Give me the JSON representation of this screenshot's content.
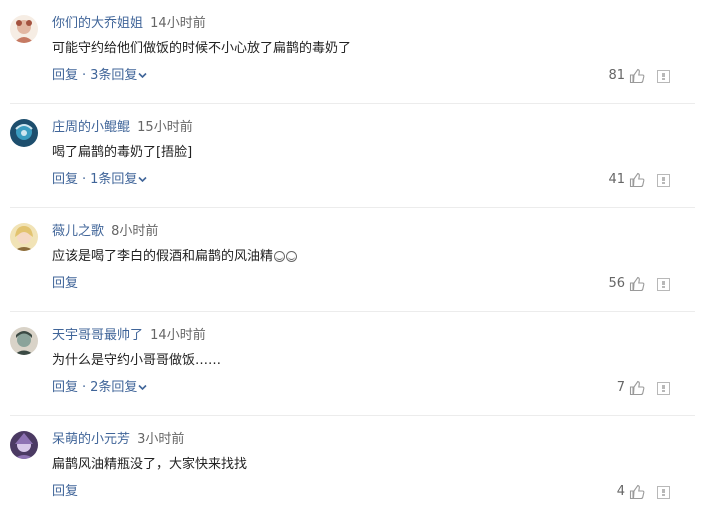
{
  "comments": [
    {
      "username": "你们的大乔姐姐",
      "time": "14小时前",
      "content": "可能守约给他们做饭的时候不小心放了扁鹊的毒奶了",
      "reply_label": "回复",
      "sep": "·",
      "replies": "3条回复",
      "likes": "81",
      "avatar_colors": [
        "#f6ede4",
        "#e2b7a2",
        "#c67a63"
      ],
      "has_emoji": false
    },
    {
      "username": "庄周的小鲲鲲",
      "time": "15小时前",
      "content": "喝了扁鹊的毒奶了[捂脸]",
      "reply_label": "回复",
      "sep": "·",
      "replies": "1条回复",
      "likes": "41",
      "avatar_colors": [
        "#1d4e6d",
        "#3a9cc0",
        "#cfe6f0"
      ],
      "has_emoji": false
    },
    {
      "username": "薇儿之歌",
      "time": "8小时前",
      "content": "应该是喝了李白的假酒和扁鹊的风油精",
      "reply_label": "回复",
      "sep": "",
      "replies": "",
      "likes": "56",
      "avatar_colors": [
        "#f1e3b6",
        "#e2c36f",
        "#8b6b3a"
      ],
      "has_emoji": true
    },
    {
      "username": "天宇哥哥最帅了",
      "time": "14小时前",
      "content": "为什么是守约小哥哥做饭……",
      "reply_label": "回复",
      "sep": "·",
      "replies": "2条回复",
      "likes": "7",
      "avatar_colors": [
        "#3b4a44",
        "#8aa39a",
        "#d9d3c8"
      ],
      "has_emoji": false
    },
    {
      "username": "呆萌的小元芳",
      "time": "3小时前",
      "content": "扁鹊风油精瓶没了，大家快来找找",
      "reply_label": "回复",
      "sep": "",
      "replies": "",
      "likes": "4",
      "avatar_colors": [
        "#4b3a63",
        "#8d72b3",
        "#d8c9ea"
      ],
      "has_emoji": false
    }
  ],
  "icons": {
    "like": "thumbs-up-icon",
    "report": "report-icon",
    "expand": "chevron-down-icon",
    "emoji": "smiley-emoji-icon"
  },
  "colors": {
    "link": "#406599",
    "text": "#222222",
    "muted": "#666666",
    "divider": "#ececec"
  }
}
